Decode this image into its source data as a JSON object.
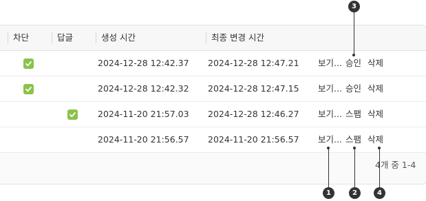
{
  "table": {
    "headers": {
      "block": "차단",
      "reply": "답글",
      "created": "생성 시간",
      "modified": "최종 변경 시간"
    },
    "rows": [
      {
        "block_checked": true,
        "reply_checked": false,
        "created": "2024-12-28 12:42.37",
        "modified": "2024-12-28 12:47.21",
        "view": "보기...",
        "status_action": "승인",
        "delete": "삭제"
      },
      {
        "block_checked": true,
        "reply_checked": false,
        "created": "2024-12-28 12:42.32",
        "modified": "2024-12-28 12:47.15",
        "view": "보기...",
        "status_action": "승인",
        "delete": "삭제"
      },
      {
        "block_checked": false,
        "reply_checked": true,
        "created": "2024-11-20 21:57.03",
        "modified": "2024-12-28 12:46.27",
        "view": "보기...",
        "status_action": "스팸",
        "delete": "삭제"
      },
      {
        "block_checked": false,
        "reply_checked": false,
        "created": "2024-11-20 21:56.57",
        "modified": "2024-11-20 21:56.57",
        "view": "보기...",
        "status_action": "스팸",
        "delete": "삭제"
      }
    ],
    "pagination": "4개 중 1-4"
  },
  "callouts": {
    "one": "1",
    "two": "2",
    "three": "3",
    "four": "4"
  },
  "colors": {
    "checkbox": "#8bc34a",
    "callout": "#333333"
  },
  "icons": {
    "checkbox": "check-icon"
  }
}
